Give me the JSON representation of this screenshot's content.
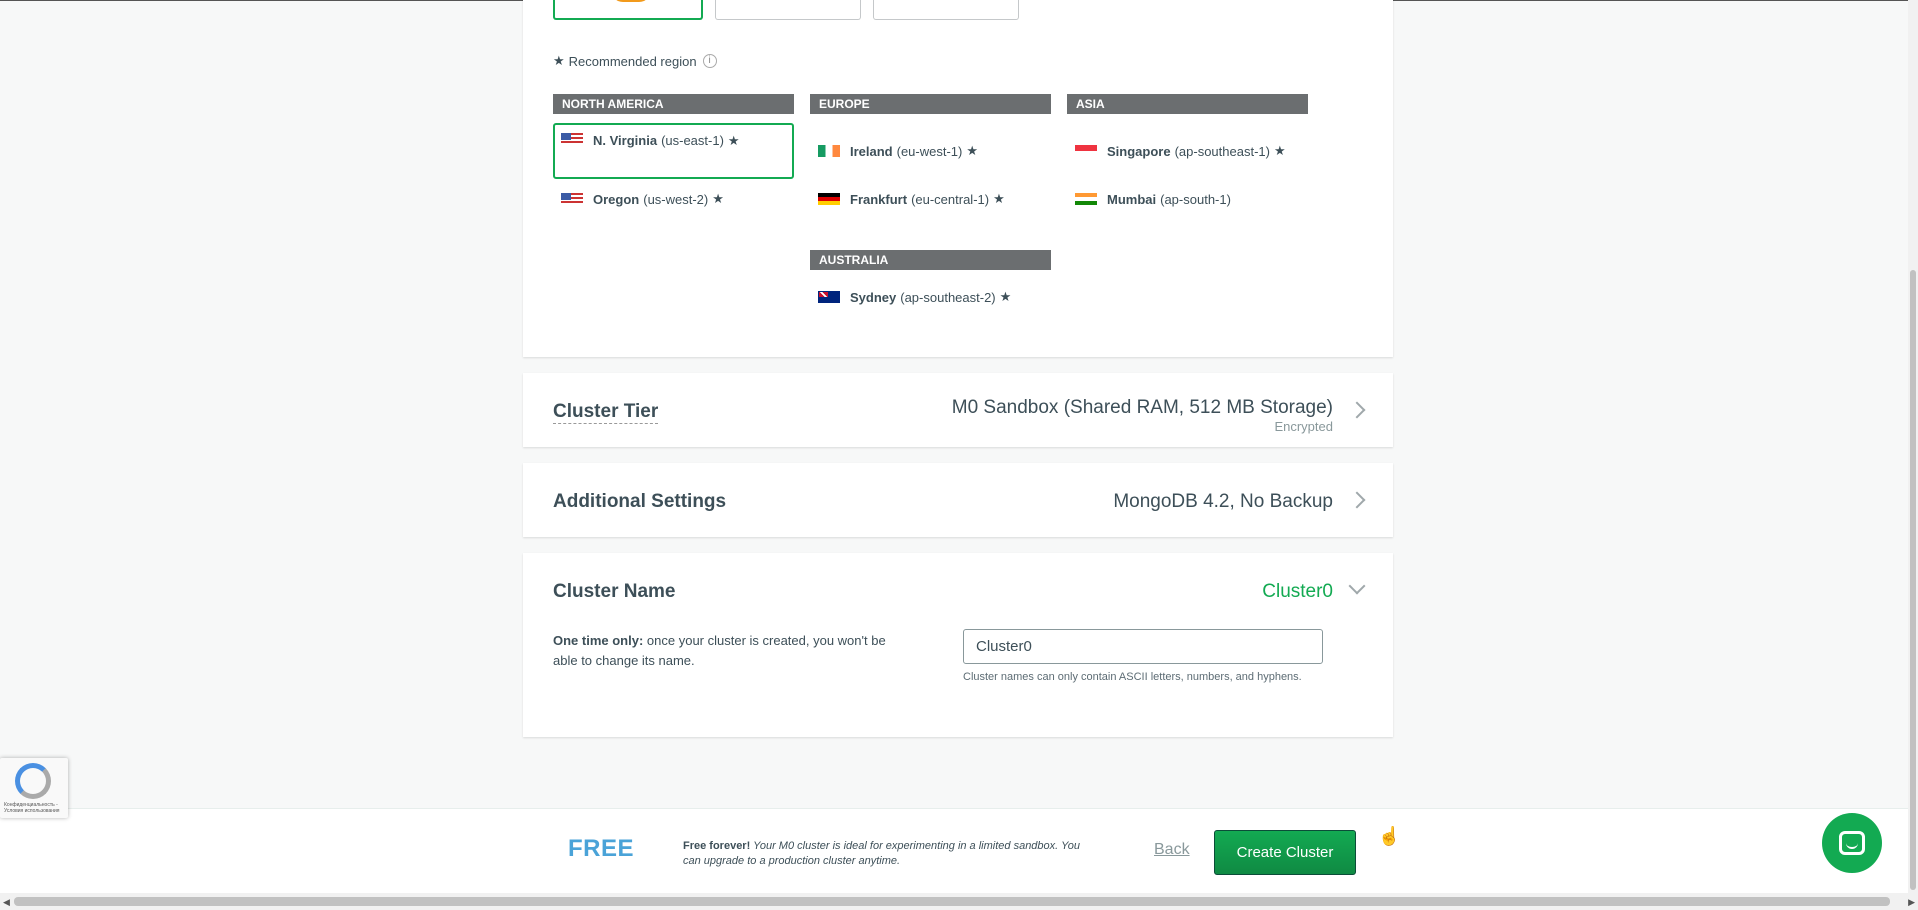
{
  "region_section": {
    "recommended_label": "Recommended region",
    "continents": [
      {
        "label": "NORTH AMERICA",
        "regions": [
          {
            "name": "N. Virginia",
            "code": "(us-east-1)",
            "recommended": true,
            "selected": true,
            "flag": "us-flag"
          },
          {
            "name": "Oregon",
            "code": "(us-west-2)",
            "recommended": true,
            "selected": false,
            "flag": "us-flag"
          }
        ]
      },
      {
        "label": "EUROPE",
        "regions": [
          {
            "name": "Ireland",
            "code": "(eu-west-1)",
            "recommended": true,
            "selected": false,
            "flag": "ie-flag"
          },
          {
            "name": "Frankfurt",
            "code": "(eu-central-1)",
            "recommended": true,
            "selected": false,
            "flag": "de-flag"
          }
        ]
      },
      {
        "label": "ASIA",
        "regions": [
          {
            "name": "Singapore",
            "code": "(ap-southeast-1)",
            "recommended": true,
            "selected": false,
            "flag": "sg-flag"
          },
          {
            "name": "Mumbai",
            "code": "(ap-south-1)",
            "recommended": false,
            "selected": false,
            "flag": "in-flag"
          }
        ]
      },
      {
        "label": "AUSTRALIA",
        "regions": [
          {
            "name": "Sydney",
            "code": "(ap-southeast-2)",
            "recommended": true,
            "selected": false,
            "flag": "au-flag"
          }
        ]
      }
    ]
  },
  "cluster_tier": {
    "title": "Cluster Tier",
    "value": "M0 Sandbox (Shared RAM, 512 MB Storage)",
    "sub": "Encrypted"
  },
  "additional_settings": {
    "title": "Additional Settings",
    "value": "MongoDB 4.2, No Backup"
  },
  "cluster_name": {
    "title": "Cluster Name",
    "value": "Cluster0",
    "note_bold": "One time only:",
    "note_text": " once your cluster is created, you won't be able to change its name.",
    "input_value": "Cluster0",
    "hint": "Cluster names can only contain ASCII letters, numbers, and hyphens."
  },
  "footer": {
    "free_label": "FREE",
    "free_bold": "Free forever!",
    "free_italic": " Your M0 cluster is ideal for experimenting in a limited sandbox.",
    "free_tail": " You can upgrade to a production cluster anytime.",
    "back_label": "Back",
    "create_label": "Create Cluster"
  },
  "recaptcha": {
    "text": "Конфиденциальность - Условия использования"
  },
  "colors": {
    "accent_green": "#13aa52",
    "free_blue": "#4aa3d8",
    "continent_bar": "#6b6e70"
  }
}
